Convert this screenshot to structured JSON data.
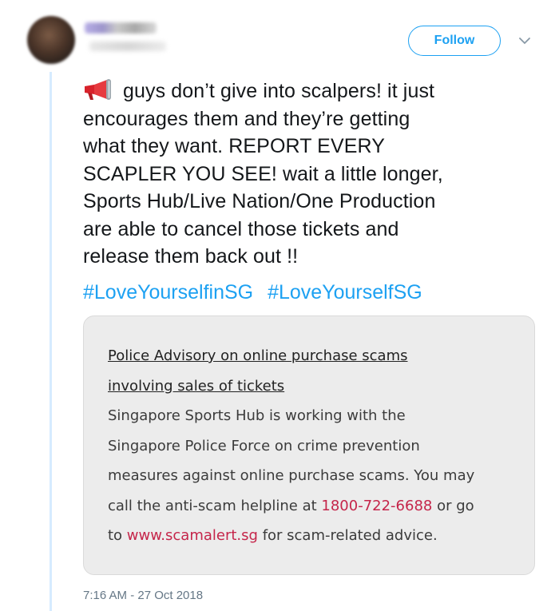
{
  "tweet": {
    "author_avatar_icon": "blurred-profile-photo",
    "follow_label": "Follow",
    "more_icon": "chevron-down-icon",
    "emoji_icon": "loudspeaker-emoji",
    "text": "guys don’t give into scalpers! it just\nencourages them and they’re getting\nwhat they want. REPORT EVERY\nSCAPLER YOU SEE! wait a little longer,\nSports Hub/Live Nation/One Production\nare able to cancel those tickets and\nrelease them back out !!",
    "hashtags": [
      "#LoveYourselfinSG",
      "#LoveYourselfSG"
    ],
    "timestamp": "7:16 AM - 27 Oct 2018"
  },
  "card": {
    "title_line1": "Police Advisory on online purchase scams",
    "title_line2": "involving sales of tickets",
    "body_line1": "Singapore Sports Hub is working with the",
    "body_line2": "Singapore Police Force on crime prevention",
    "body_line3": "measures against online purchase scams. You may",
    "body_line4_pre": "call the anti-scam helpline at ",
    "phone": "1800-722-6688",
    "body_line4_post": " or go",
    "body_line5_pre": "to ",
    "website": "www.scamalert.sg",
    "body_line5_post": " for scam-related advice."
  },
  "colors": {
    "accent": "#1da1f2",
    "link_red": "#c5254a",
    "card_bg": "#ececec",
    "thread_line": "#d6ebff"
  }
}
